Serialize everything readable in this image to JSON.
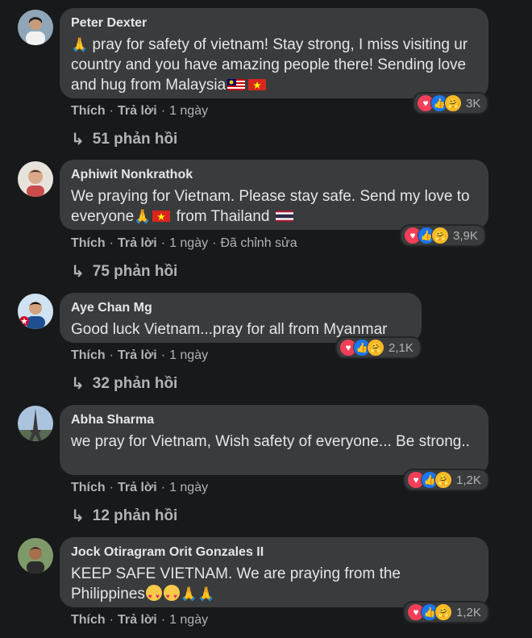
{
  "comments": [
    {
      "author": "Peter Dexter",
      "text_parts": [
        "pray for safety of vietnam! Stay strong, I miss visiting ur country and you have amazing people there! Sending love and hug from Malaysia"
      ],
      "like_label": "Thích",
      "reply_label": "Trả lời",
      "time": "1 ngày",
      "edited": "",
      "reaction_count": "3K",
      "replies_label": "51 phản hồi"
    },
    {
      "author": "Aphiwit Nonkrathok",
      "text_parts": [
        "We praying for Vietnam. Please stay safe. Send my love to everyone",
        "from Thailand"
      ],
      "like_label": "Thích",
      "reply_label": "Trả lời",
      "time": "1 ngày",
      "edited": "Đã chỉnh sửa",
      "reaction_count": "3,9K",
      "replies_label": "75 phản hồi"
    },
    {
      "author": "Aye Chan Mg",
      "text_parts": [
        "Good luck Vietnam...pray for all from Myanmar"
      ],
      "like_label": "Thích",
      "reply_label": "Trả lời",
      "time": "1 ngày",
      "edited": "",
      "reaction_count": "2,1K",
      "replies_label": "32 phản hồi"
    },
    {
      "author": "Abha Sharma",
      "text_parts": [
        "we pray for Vietnam, Wish safety of everyone... Be strong.."
      ],
      "like_label": "Thích",
      "reply_label": "Trả lời",
      "time": "1 ngày",
      "edited": "",
      "reaction_count": "1,2K",
      "replies_label": "12 phản hồi"
    },
    {
      "author": "Jock Otiragram Orit Gonzales II",
      "text_parts": [
        "KEEP SAFE VIETNAM. We are praying from the Philippines"
      ],
      "like_label": "Thích",
      "reply_label": "Trả lời",
      "time": "1 ngày",
      "edited": "",
      "reaction_count": "1,2K",
      "replies_label": ""
    }
  ],
  "icons": {
    "reaction_love": "heart-icon",
    "reaction_like": "thumbs-up-icon",
    "reaction_care": "care-icon",
    "reply_arrow": "reply-arrow-icon"
  },
  "colors": {
    "background": "#18191a",
    "bubble": "#3a3b3c",
    "text": "#e4e6eb",
    "secondary": "#b0b3b8",
    "like_blue": "#1877f2",
    "love_red": "#f33e58"
  }
}
